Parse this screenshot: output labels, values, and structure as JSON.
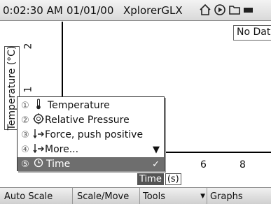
{
  "statusbar": {
    "time": "0:02:30 AM",
    "date": "01/01/00",
    "device": "XplorerGLX",
    "icons": [
      "home-icon",
      "play-icon",
      "folder-icon",
      "battery-icon"
    ]
  },
  "graph": {
    "y_axis_label": "Temperature (°C)",
    "y_ticks": [
      "2",
      "1"
    ],
    "x_ticks": [
      "6",
      "8"
    ],
    "no_data": "No Data",
    "x_axis_selected": "Time",
    "x_axis_unit": "(s)"
  },
  "menu": {
    "items": [
      {
        "num": "①",
        "icon": "thermometer-icon",
        "label": "Temperature"
      },
      {
        "num": "②",
        "icon": "pressure-gauge-icon",
        "label": "Relative Pressure"
      },
      {
        "num": "③",
        "icon": "force-icon",
        "label": "Force, push positive"
      },
      {
        "num": "④",
        "icon": "force-icon",
        "label": "More..."
      },
      {
        "num": "⑤",
        "icon": "clock-icon",
        "label": "Time"
      }
    ],
    "selected_index": 4
  },
  "toolbar": {
    "tabs": [
      "Auto Scale",
      "Scale/Move",
      "Tools",
      "Graphs"
    ]
  }
}
